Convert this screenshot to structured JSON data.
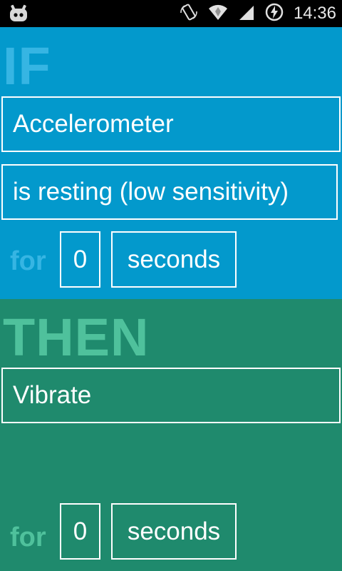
{
  "status_bar": {
    "time": "14:36",
    "icons": [
      "cyanogenmod-android-icon",
      "rotate-icon",
      "wifi-icon",
      "signal-icon",
      "battery-charging-icon"
    ]
  },
  "if_block": {
    "heading": "IF",
    "sensor": "Accelerometer",
    "condition": "is resting (low sensitivity)",
    "for_label": "for",
    "duration_value": "0",
    "duration_unit": "seconds"
  },
  "then_block": {
    "heading": "THEN",
    "action": "Vibrate",
    "for_label": "for",
    "duration_value": "0",
    "duration_unit": "seconds"
  },
  "colors": {
    "if_background": "#0399cc",
    "if_accent": "#36b5e3",
    "then_background": "#1f8a6d",
    "then_accent": "#4fc19c",
    "field_border": "#ffffff"
  }
}
